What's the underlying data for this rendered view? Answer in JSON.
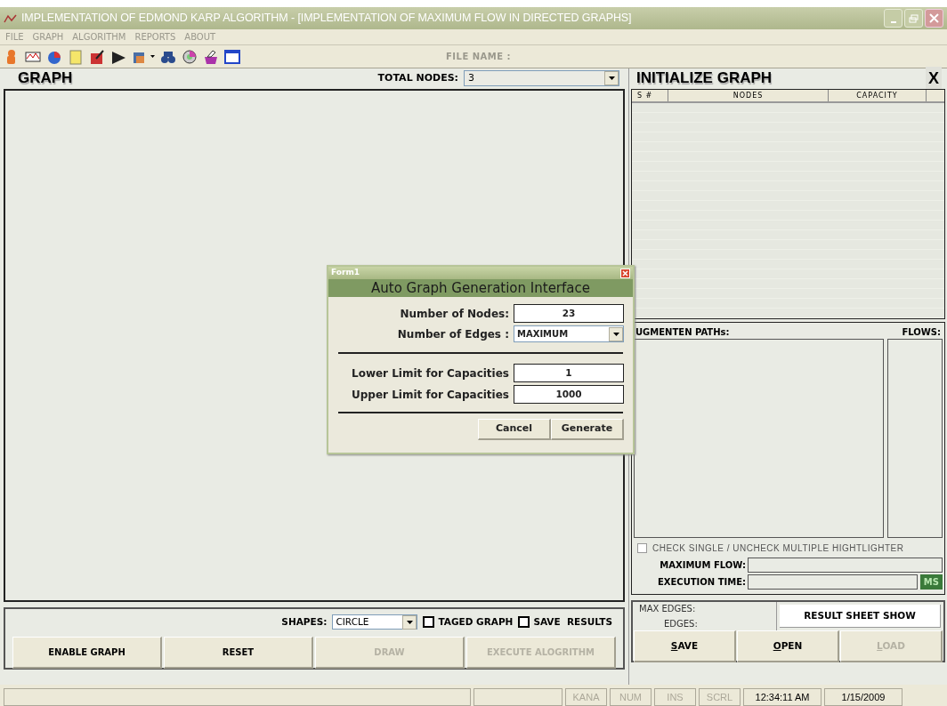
{
  "window": {
    "title": "IMPLEMENTATION OF EDMOND KARP ALGORITHM - [IMPLEMENTATION OF MAXIMUM FLOW IN DIRECTED GRAPHS]"
  },
  "menu": [
    "FILE",
    "GRAPH",
    "ALGORITHM",
    "REPORTS",
    "ABOUT"
  ],
  "toolbar": {
    "file_name_label": "FILE NAME :"
  },
  "graph_panel": {
    "title": "GRAPH",
    "total_nodes_label": "TOTAL NODES:",
    "total_nodes_value": "3"
  },
  "bottom_left": {
    "shapes_label": "SHAPES:",
    "shape_value": "CIRCLE",
    "options": [
      {
        "label": "TAGED GRAPH",
        "checked": false
      },
      {
        "label": "SAVE  RESULTS",
        "checked": false
      }
    ],
    "buttons": [
      {
        "label": "ENABLE GRAPH",
        "disabled": false
      },
      {
        "label": "RESET",
        "disabled": false
      },
      {
        "label": "DRAW",
        "disabled": true
      },
      {
        "label": "EXECUTE ALOGRITHM",
        "disabled": true
      }
    ]
  },
  "initialize_panel": {
    "title": "INITIALIZE GRAPH",
    "close": "X",
    "columns": [
      "S #",
      "NODES",
      "CAPACITY"
    ]
  },
  "results": {
    "paths_label": "UGMENTEN PATHs:",
    "flows_label": "FLOWS:",
    "highlighter": {
      "label": "CHECK SINGLE / UNCHECK MULTIPLE HIGHTLIGHTER",
      "checked": false
    },
    "max_flow_label": "MAXIMUM FLOW:",
    "execution_time_label": "EXECUTION TIME:",
    "unit": "MS"
  },
  "bottom_right": {
    "max_edges_label": "MAX EDGES:",
    "edges_label": "EDGES:",
    "result_button": "RESULT SHEET SHOW",
    "buttons": [
      {
        "label": "SAVE",
        "disabled": false,
        "underline_first": true
      },
      {
        "label": "OPEN",
        "disabled": false,
        "underline_first": true
      },
      {
        "label": "LOAD",
        "disabled": true,
        "underline_first": true
      }
    ]
  },
  "dialog": {
    "title": "Form1",
    "heading": "Auto Graph Generation Interface",
    "nodes_label": "Number of Nodes:",
    "nodes_value": "23",
    "edges_label": "Number of Edges :",
    "edges_value": "MAXIMUM",
    "lower_label": "Lower Limit for Capacities",
    "lower_value": "1",
    "upper_label": "Upper Limit for Capacities",
    "upper_value": "1000",
    "buttons": [
      "Cancel",
      "Generate"
    ]
  },
  "status_bar": [
    {
      "text": "KANA",
      "disabled": true
    },
    {
      "text": "NUM",
      "disabled": true
    },
    {
      "text": "INS",
      "disabled": true
    },
    {
      "text": "SCRL",
      "disabled": true
    },
    {
      "text": "12:34:11 AM",
      "disabled": false
    },
    {
      "text": "1/15/2009",
      "disabled": false
    }
  ]
}
